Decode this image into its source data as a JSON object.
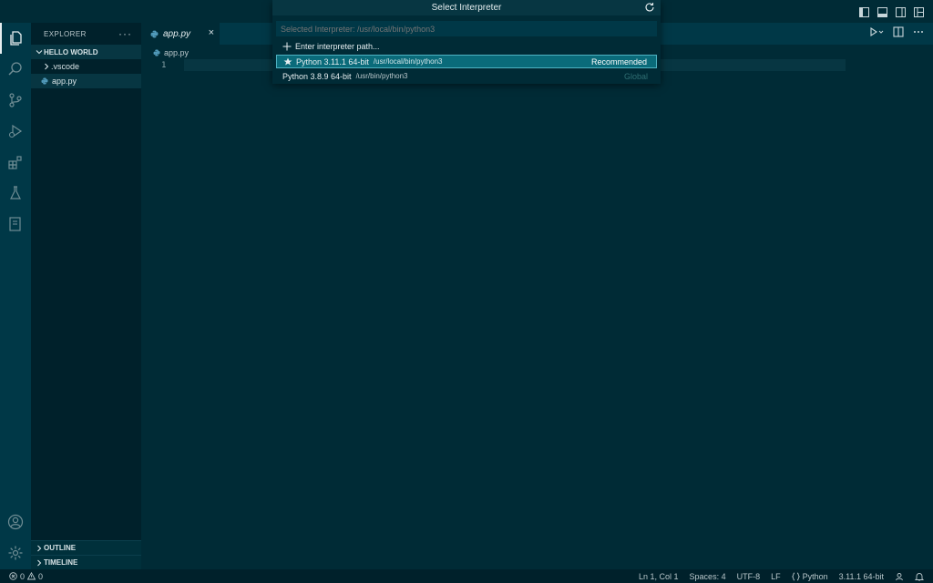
{
  "window": {
    "title": "Select Interpreter"
  },
  "explorer": {
    "header": "EXPLORER",
    "more": "···",
    "folder": "HELLO WORLD",
    "items": [
      {
        "label": ".vscode",
        "type": "folder"
      },
      {
        "label": "app.py",
        "type": "file"
      }
    ],
    "outline": "OUTLINE",
    "timeline": "TIMELINE"
  },
  "editor": {
    "tab_label": "app.py",
    "tab_close": "×",
    "breadcrumb_file": "app.py",
    "line_number": "1"
  },
  "quickpick": {
    "title": "Select Interpreter",
    "placeholder": "Selected Interpreter: /usr/local/bin/python3",
    "enter_path": "Enter interpreter path...",
    "options": [
      {
        "name": "Python 3.11.1 64-bit",
        "path": "/usr/local/bin/python3",
        "tag": "Recommended",
        "selected": true,
        "icon": "star-icon"
      },
      {
        "name": "Python 3.8.9 64-bit",
        "path": "/usr/bin/python3",
        "tag": "Global",
        "selected": false
      }
    ]
  },
  "statusbar": {
    "errors": "0",
    "warnings": "0",
    "position": "Ln 1, Col 1",
    "spaces": "Spaces: 4",
    "encoding": "UTF-8",
    "eol": "LF",
    "language": "Python",
    "interpreter": "3.11.1 64-bit"
  },
  "colors": {
    "background": "#002b36",
    "sidebar": "#00212b",
    "activitybar": "#003847",
    "selection": "#0a6b7a",
    "python_icon": "#519aba"
  }
}
